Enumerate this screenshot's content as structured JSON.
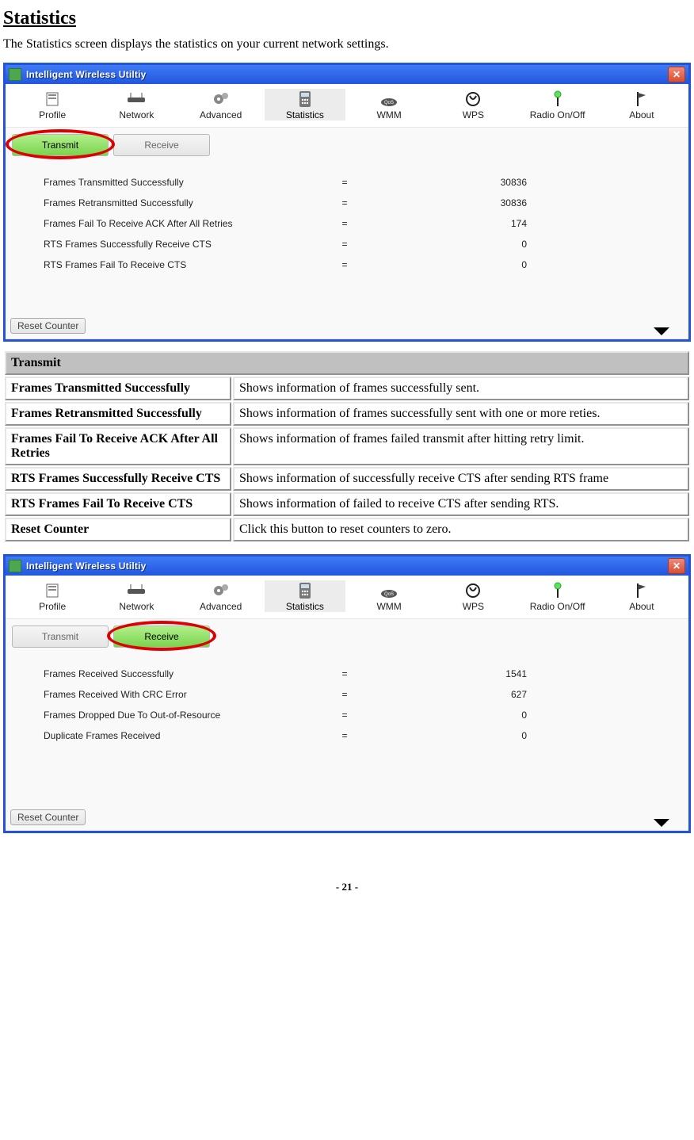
{
  "page": {
    "title": "Statistics",
    "intro": "The Statistics screen displays the statistics on your current network settings.",
    "footer": "- 21 -"
  },
  "window": {
    "title": "Intelligent Wireless Utiltiy",
    "tabs": [
      {
        "label": "Profile"
      },
      {
        "label": "Network"
      },
      {
        "label": "Advanced"
      },
      {
        "label": "Statistics"
      },
      {
        "label": "WMM"
      },
      {
        "label": "WPS"
      },
      {
        "label": "Radio On/Off"
      },
      {
        "label": "About"
      }
    ],
    "subtabs": {
      "transmit": "Transmit",
      "receive": "Receive"
    },
    "reset": "Reset Counter"
  },
  "transmit_stats": [
    {
      "label": "Frames Transmitted Successfully",
      "eq": "=",
      "val": "30836"
    },
    {
      "label": "Frames Retransmitted Successfully",
      "eq": "=",
      "val": "30836"
    },
    {
      "label": "Frames Fail To Receive ACK After All Retries",
      "eq": "=",
      "val": "174"
    },
    {
      "label": "RTS Frames Successfully Receive CTS",
      "eq": "=",
      "val": "0"
    },
    {
      "label": "RTS Frames Fail To Receive CTS",
      "eq": "=",
      "val": "0"
    }
  ],
  "receive_stats": [
    {
      "label": "Frames Received Successfully",
      "eq": "=",
      "val": "1541"
    },
    {
      "label": "Frames Received With CRC Error",
      "eq": "=",
      "val": "627"
    },
    {
      "label": "Frames Dropped Due To Out-of-Resource",
      "eq": "=",
      "val": "0"
    },
    {
      "label": "Duplicate Frames Received",
      "eq": "=",
      "val": "0"
    }
  ],
  "def_table": {
    "header": "Transmit",
    "rows": [
      {
        "k": "Frames Transmitted Successfully",
        "v": "Shows information of frames successfully sent."
      },
      {
        "k": "Frames Retransmitted Successfully",
        "v": "Shows information of frames successfully sent with one or more reties."
      },
      {
        "k": "Frames Fail To Receive ACK After All Retries",
        "v": "Shows information of frames failed transmit after hitting retry limit."
      },
      {
        "k": "RTS Frames Successfully Receive CTS",
        "v": "Shows information of successfully receive CTS after sending RTS frame"
      },
      {
        "k": "RTS Frames Fail To Receive CTS",
        "v": "Shows information of failed to receive CTS after sending RTS."
      },
      {
        "k": "Reset Counter",
        "v": "Click this button to reset counters to zero."
      }
    ]
  }
}
